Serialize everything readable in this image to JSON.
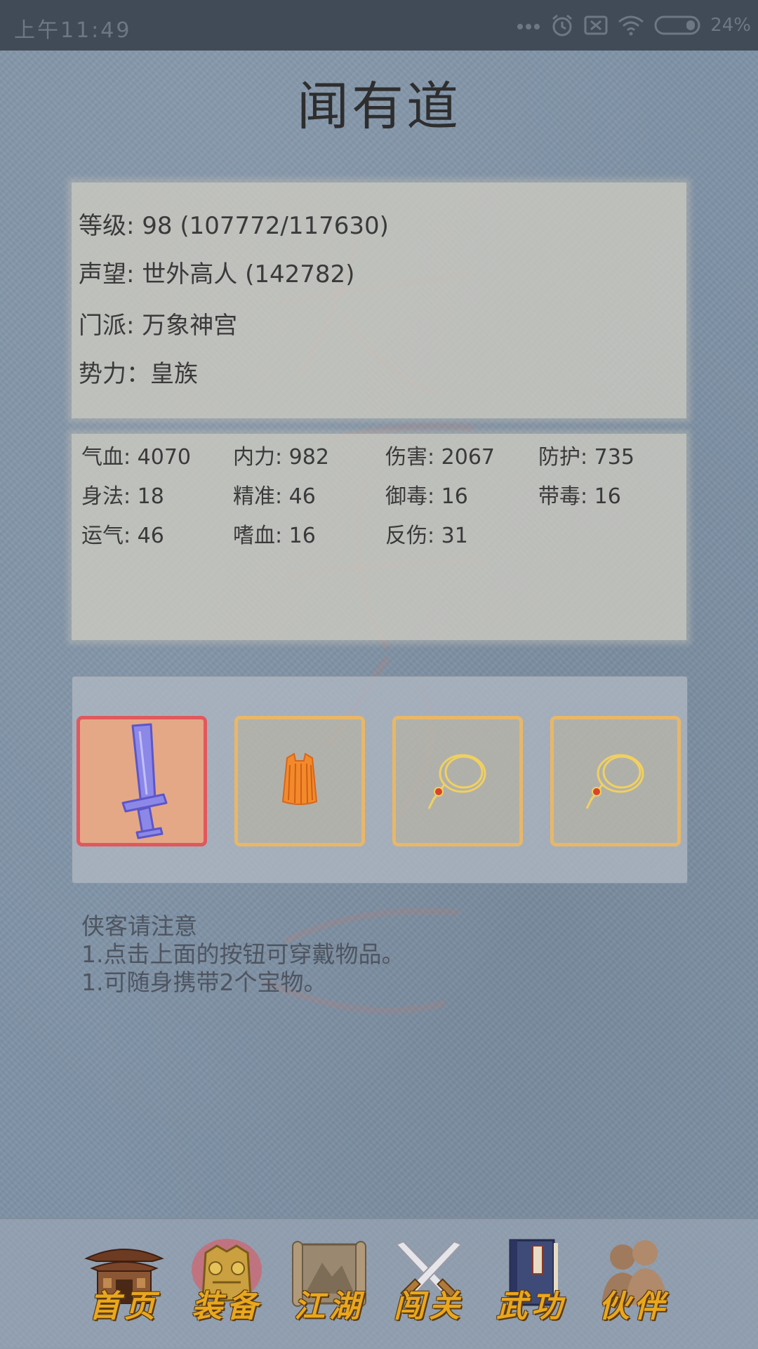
{
  "status_bar": {
    "time": "上午11:49",
    "battery": "24%",
    "icons": [
      "more-dots-icon",
      "alarm-icon",
      "no-sim-icon",
      "wifi-icon",
      "battery-icon"
    ]
  },
  "title": "闻有道",
  "info": {
    "level": "等级: 98 (107772/117630)",
    "reputation": "声望: 世外高人 (142782)",
    "sect": "门派: 万象神宫",
    "faction": "势力：皇族"
  },
  "stats": [
    [
      "气血: 4070",
      "内力: 982",
      "伤害: 2067",
      "防护: 735"
    ],
    [
      "身法: 18",
      "精准: 46",
      "御毒: 16",
      "带毒: 16"
    ],
    [
      "运气: 46",
      "嗜血: 16",
      "反伤: 31",
      ""
    ]
  ],
  "equipment": [
    {
      "name": "sword-icon",
      "active": true
    },
    {
      "name": "armor-icon",
      "active": false
    },
    {
      "name": "necklace-icon",
      "active": false
    },
    {
      "name": "necklace-icon",
      "active": false
    }
  ],
  "notes": {
    "heading": "侠客请注意",
    "line1": "1.点击上面的按钮可穿戴物品。",
    "line2": "1.可随身携带2个宝物。"
  },
  "nav": [
    {
      "label": "首页",
      "icon": "temple-icon"
    },
    {
      "label": "装备",
      "icon": "armor-icon"
    },
    {
      "label": "江湖",
      "icon": "map-scroll-icon"
    },
    {
      "label": "闯关",
      "icon": "crossed-swords-icon"
    },
    {
      "label": "武功",
      "icon": "book-icon"
    },
    {
      "label": "伙伴",
      "icon": "companions-icon"
    }
  ],
  "colors": {
    "background": "#7f92a6",
    "nav_label": "#e9a71e",
    "slot_border": "#e8b767",
    "slot_active_border": "#e0585c"
  }
}
